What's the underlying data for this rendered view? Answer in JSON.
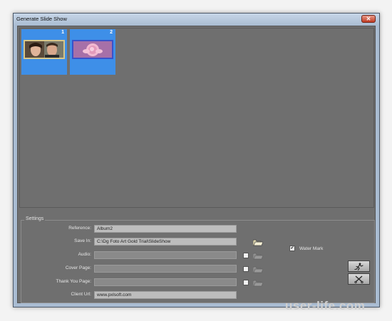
{
  "window": {
    "title": "Generate Slide Show"
  },
  "gallery": {
    "items": [
      {
        "number": "1",
        "image": "two-people-photo",
        "frame_color": "#d6c68a"
      },
      {
        "number": "2",
        "image": "pink-rose-photo",
        "frame_color": "#3a52c9"
      }
    ],
    "selection_color": "#3e8fe8"
  },
  "settings": {
    "legend": "Settings",
    "reference": {
      "label": "Reference:",
      "value": "Album2"
    },
    "save_in": {
      "label": "Save In:",
      "value": "C:\\Dg Foto Art Gold Trial\\SlideShow"
    },
    "audio": {
      "label": "Audio:",
      "value": ""
    },
    "cover_page": {
      "label": "Cover Page:",
      "value": ""
    },
    "thank_you_page": {
      "label": "Thank You Page:",
      "value": ""
    },
    "client_url": {
      "label": "Client Url:",
      "value": "www.pxlsoft.com"
    },
    "water_mark": {
      "label": "Water Mark",
      "checked": true
    }
  },
  "actions": {
    "generate": {
      "icon": "running-man-icon"
    },
    "cancel": {
      "icon": "scissors-icon"
    }
  },
  "watermark_text": "user-life.com"
}
